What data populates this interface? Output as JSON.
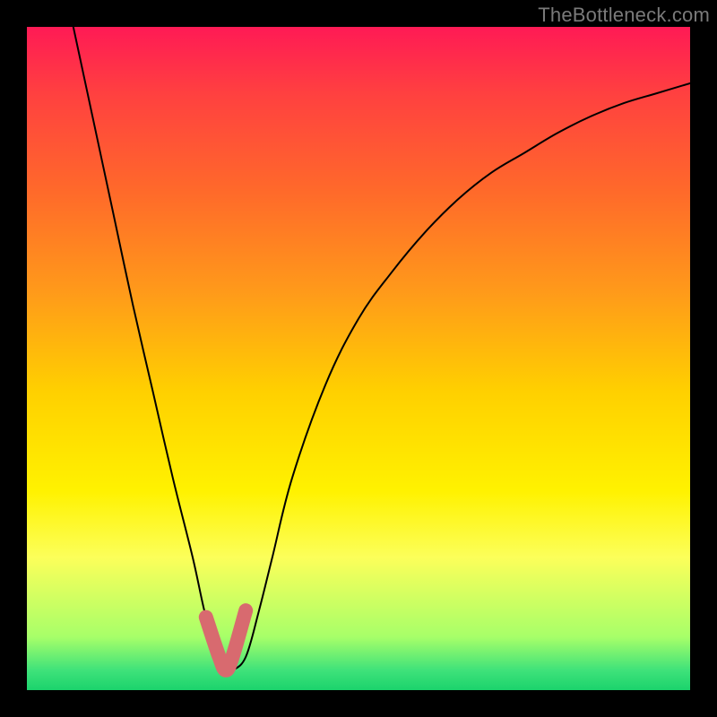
{
  "watermark": "TheBottleneck.com",
  "chart_data": {
    "type": "line",
    "title": "",
    "xlabel": "",
    "ylabel": "",
    "xlim": [
      0,
      100
    ],
    "ylim": [
      0,
      100
    ],
    "series": [
      {
        "name": "curve",
        "x": [
          7,
          10,
          13,
          16,
          19,
          22,
          25,
          27,
          29,
          30,
          31,
          33,
          35,
          37,
          40,
          45,
          50,
          55,
          60,
          65,
          70,
          75,
          80,
          85,
          90,
          95,
          100
        ],
        "values": [
          100,
          86,
          72,
          58,
          45,
          32,
          20,
          11,
          5,
          3,
          3,
          5,
          12,
          20,
          32,
          46,
          56,
          63,
          69,
          74,
          78,
          81,
          84,
          86.5,
          88.5,
          90,
          91.5
        ]
      },
      {
        "name": "highlight",
        "x": [
          27,
          29,
          30,
          31,
          33
        ],
        "values": [
          11,
          5,
          3,
          5,
          12
        ]
      }
    ],
    "colors": {
      "curve": "#000000",
      "highlight": "#d86a6f"
    }
  }
}
